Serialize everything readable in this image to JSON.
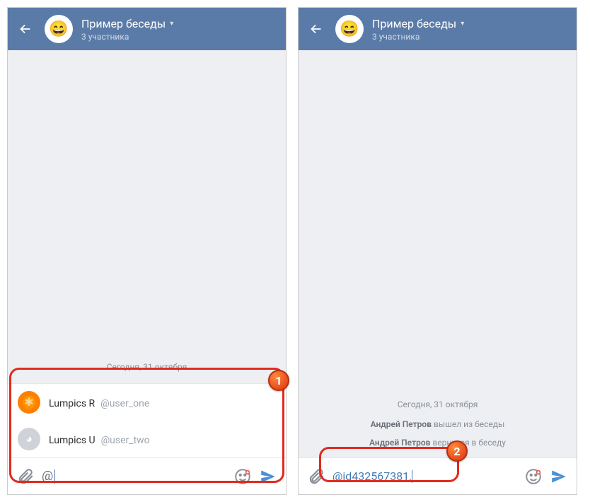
{
  "left": {
    "header": {
      "title": "Пример беседы",
      "subtitle": "3 участника"
    },
    "date_divider": "Сегодня, 31 октября",
    "suggestions": [
      {
        "name": "Lumpics R",
        "handle": "@user_one",
        "avatar_kind": "orange"
      },
      {
        "name": "Lumpics U",
        "handle": "@user_two",
        "avatar_kind": "gray"
      }
    ],
    "input_value": "@"
  },
  "right": {
    "header": {
      "title": "Пример беседы",
      "subtitle": "3 участника"
    },
    "date_divider": "Сегодня, 31 октября",
    "system_messages": [
      {
        "actor": "Андрей Петров",
        "text": " вышел из беседы"
      },
      {
        "actor": "Андрей Петров",
        "text": " вернулся в беседу"
      }
    ],
    "input_value": "@id432567381,"
  },
  "badges": {
    "one": "1",
    "two": "2"
  },
  "colors": {
    "header_bg": "#5a7ba8",
    "chat_bg": "#edeff2",
    "accent": "#4a90d9",
    "highlight": "#e12a1f",
    "mention": "#3f7ab6"
  },
  "icons": {
    "back": "back-arrow-icon",
    "attach": "paperclip-icon",
    "emoji": "smiley-icon",
    "send": "send-icon",
    "chevron": "chevron-down-icon"
  }
}
